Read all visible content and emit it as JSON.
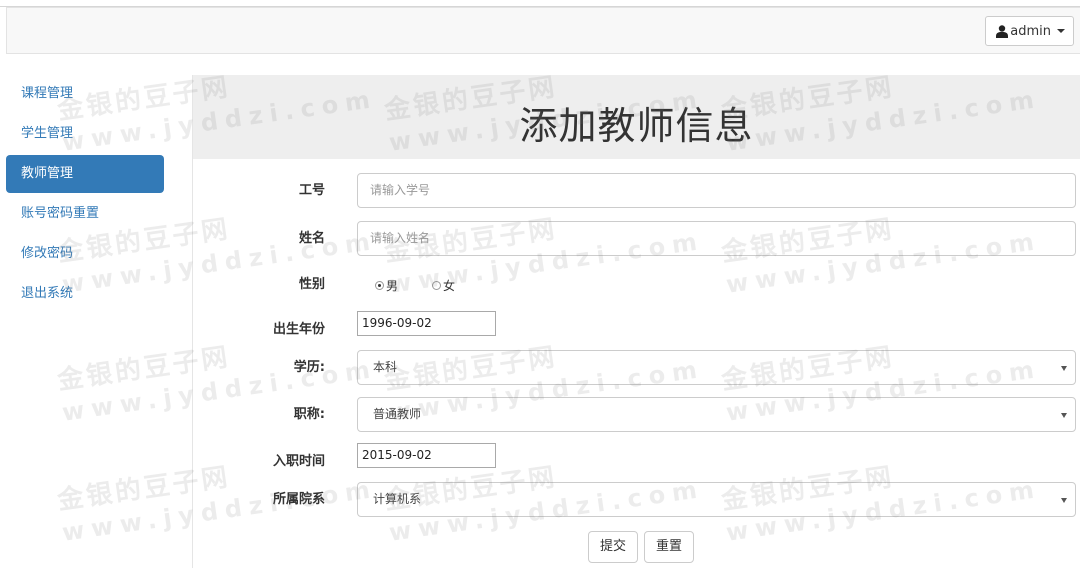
{
  "navbar": {
    "user_label": "admin"
  },
  "sidebar": {
    "items": [
      {
        "label": "课程管理",
        "active": false
      },
      {
        "label": "学生管理",
        "active": false
      },
      {
        "label": "教师管理",
        "active": true
      },
      {
        "label": "账号密码重置",
        "active": false
      },
      {
        "label": "修改密码",
        "active": false
      },
      {
        "label": "退出系统",
        "active": false
      }
    ]
  },
  "page": {
    "title": "添加教师信息"
  },
  "form": {
    "id_label": "工号",
    "id_placeholder": "请输入学号",
    "name_label": "姓名",
    "name_placeholder": "请输入姓名",
    "gender_label": "性别",
    "gender_options": [
      "男",
      "女"
    ],
    "gender_selected": "男",
    "birth_label": "出生年份",
    "birth_value": "1996-09-02",
    "education_label": "学历:",
    "education_value": "本科",
    "title_label": "职称:",
    "title_value": "普通教师",
    "hire_label": "入职时间",
    "hire_value": "2015-09-02",
    "dept_label": "所属院系",
    "dept_value": "计算机系",
    "submit_label": "提交",
    "reset_label": "重置"
  },
  "watermark": {
    "cn": "金银的豆子网",
    "en": "www.jyddzi.com"
  },
  "colors": {
    "primary": "#337ab7",
    "jumbotron": "#eeeeee",
    "navbar": "#f8f8f8"
  }
}
